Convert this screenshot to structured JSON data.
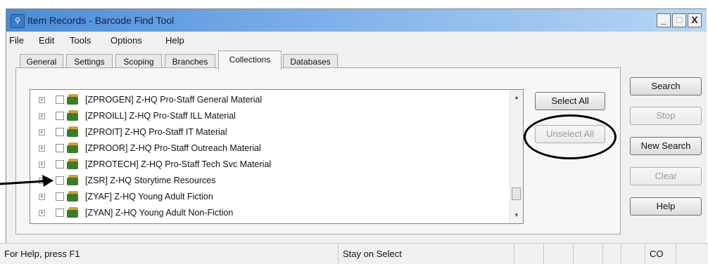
{
  "window": {
    "title": "Item Records - Barcode Find Tool",
    "controls": {
      "minimize": "_",
      "maximize": "□",
      "close": "X"
    }
  },
  "menu": [
    "File",
    "Edit",
    "Tools",
    "Options",
    "Help"
  ],
  "tabs": [
    {
      "label": "General",
      "active": false
    },
    {
      "label": "Settings",
      "active": false
    },
    {
      "label": "Scoping",
      "active": false
    },
    {
      "label": "Branches",
      "active": false
    },
    {
      "label": "Collections",
      "active": true
    },
    {
      "label": "Databases",
      "active": false
    }
  ],
  "collections": [
    "[ZPROGEN] Z-HQ Pro-Staff General Material",
    "[ZPROILL] Z-HQ Pro-Staff ILL Material",
    "[ZPROIT] Z-HQ Pro-Staff IT Material",
    "[ZPROOR] Z-HQ Pro-Staff Outreach Material",
    "[ZPROTECH] Z-HQ Pro-Staff Tech Svc Material",
    "[ZSR] Z-HQ Storytime Resources",
    "[ZYAF] Z-HQ Young Adult Fiction",
    "[ZYAN] Z-HQ Young Adult Non-Fiction"
  ],
  "list_buttons": {
    "select_all": "Select All",
    "unselect_all": "Unselect All"
  },
  "action_buttons": {
    "search": "Search",
    "stop": "Stop",
    "new_search": "New Search",
    "clear": "Clear",
    "help": "Help"
  },
  "statusbar": {
    "help_text": "For Help, press F1",
    "mode": "Stay on Select",
    "indicator": "CO"
  }
}
